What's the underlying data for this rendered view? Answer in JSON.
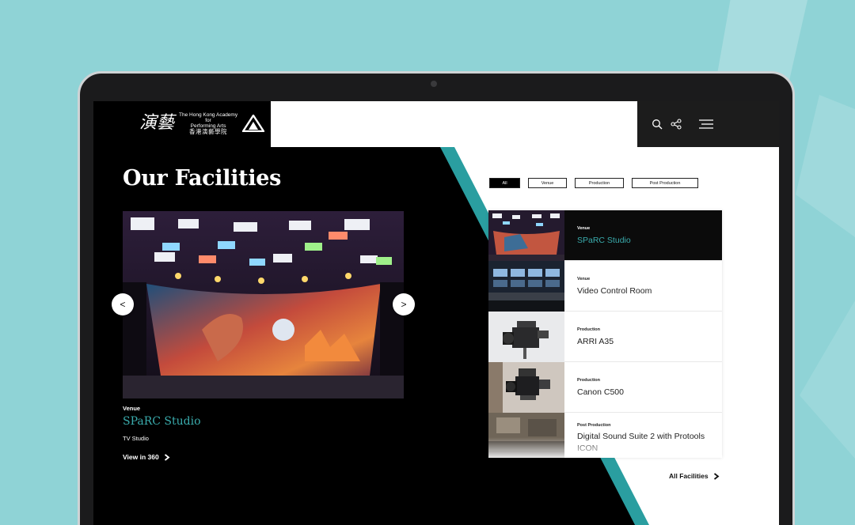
{
  "colors": {
    "background": "#8fd3d6",
    "accent": "#2a9ea0",
    "highlight_text": "#3aacad",
    "screen_dark": "#000000"
  },
  "header": {
    "logo": {
      "en_line1": "The Hong Kong Academy",
      "en_line2": "for",
      "en_line3": "Performing Arts",
      "cn": "香港演藝學院"
    },
    "icons": [
      "search-icon",
      "share-icon",
      "menu-icon"
    ]
  },
  "hero": {
    "title": "Our Facilities",
    "category": "Venue",
    "name": "SPaRC Studio",
    "type": "TV Studio",
    "link_label": "View in 360",
    "prev_label": "<",
    "next_label": ">"
  },
  "filters": [
    {
      "label": "All",
      "active": true
    },
    {
      "label": "Venue",
      "active": false
    },
    {
      "label": "Production",
      "active": false
    },
    {
      "label": "Post Production",
      "active": false
    }
  ],
  "facilities": [
    {
      "category": "Venue",
      "name": "SPaRC Studio",
      "active": true
    },
    {
      "category": "Venue",
      "name": "Video Control Room",
      "active": false
    },
    {
      "category": "Production",
      "name": "ARRI A35",
      "active": false
    },
    {
      "category": "Production",
      "name": "Canon C500",
      "active": false
    },
    {
      "category": "Post Production",
      "name": "Digital Sound Suite 2 with Protools ICON",
      "active": false
    }
  ],
  "all_link": "All Facilities"
}
